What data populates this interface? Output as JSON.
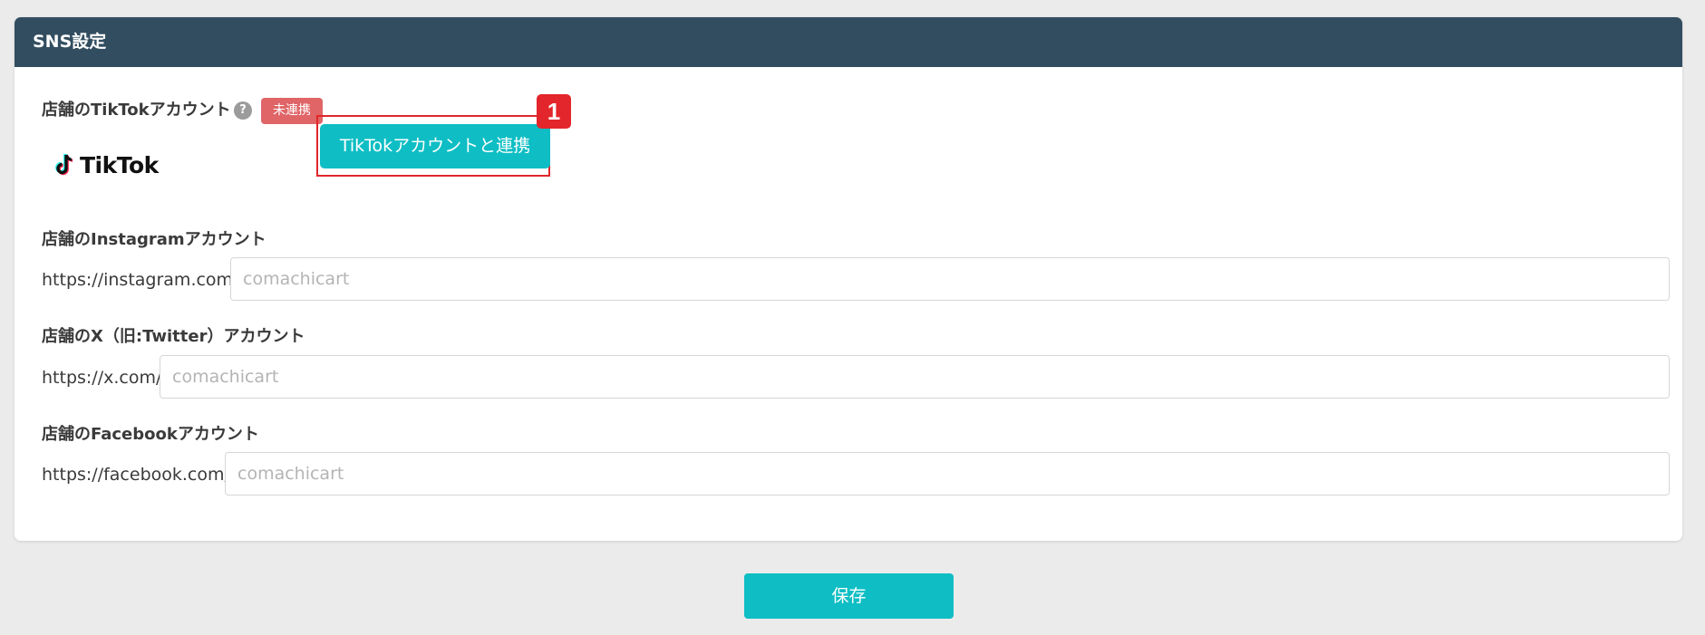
{
  "panel": {
    "title": "SNS設定"
  },
  "tiktok": {
    "label": "店舗のTikTokアカウント",
    "help_icon": "question-mark-icon",
    "help_glyph": "?",
    "status_badge": "未連携",
    "status_color": "#e06567",
    "logo_text": "TikTok",
    "connect_button": "TikTokアカウントと連携",
    "step_marker": "1"
  },
  "instagram": {
    "label": "店舗のInstagramアカウント",
    "prefix": "https://instagram.com/",
    "value": "",
    "placeholder": "comachicart"
  },
  "x": {
    "label": "店舗のX（旧:Twitter）アカウント",
    "prefix": "https://x.com/",
    "value": "",
    "placeholder": "comachicart"
  },
  "facebook": {
    "label": "店舗のFacebookアカウント",
    "prefix": "https://facebook.com/",
    "value": "",
    "placeholder": "comachicart"
  },
  "footer": {
    "save_button": "保存"
  },
  "colors": {
    "header": "#324d60",
    "accent": "#0ebec4",
    "highlight": "#e0262b",
    "background": "#ebebeb"
  }
}
